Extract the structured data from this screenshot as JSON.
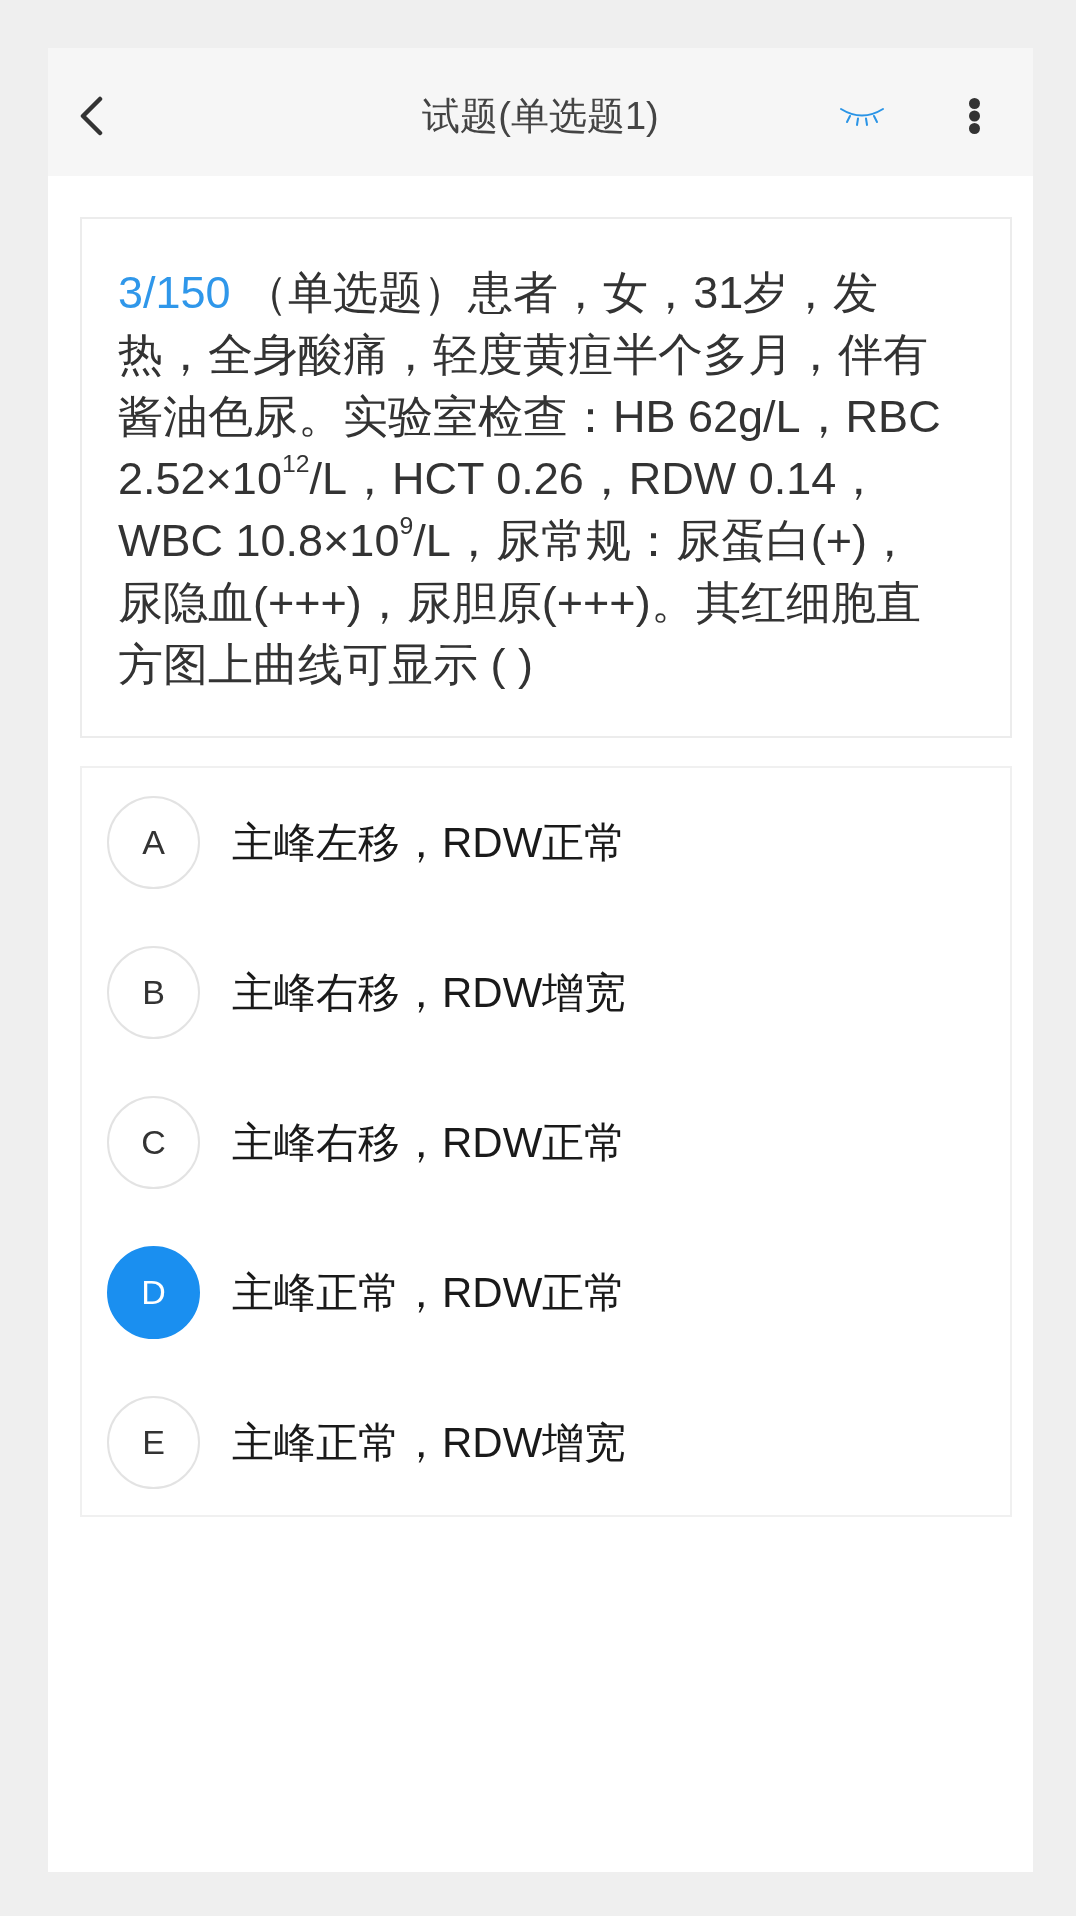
{
  "header": {
    "title": "试题(单选题1)"
  },
  "question": {
    "number": "3/150",
    "text": "（单选题）患者，女，31岁，发热，全身酸痛，轻度黄疸半个多月，伴有酱油色尿。实验室检查：HB 62g/L，RBC 2.52×10$^{12}$/L，HCT 0.26，RDW 0.14，WBC 10.8×10$^{9}$/L，尿常规：尿蛋白(+)，尿隐血(+++)，尿胆原(+++)。其红细胞直方图上曲线可显示 ( )"
  },
  "options": [
    {
      "letter": "A",
      "text": "主峰左移，RDW正常",
      "selected": false
    },
    {
      "letter": "B",
      "text": "主峰右移，RDW增宽",
      "selected": false
    },
    {
      "letter": "C",
      "text": "主峰右移，RDW正常",
      "selected": false
    },
    {
      "letter": "D",
      "text": "主峰正常，RDW正常",
      "selected": true
    },
    {
      "letter": "E",
      "text": "主峰正常，RDW增宽",
      "selected": false
    }
  ]
}
